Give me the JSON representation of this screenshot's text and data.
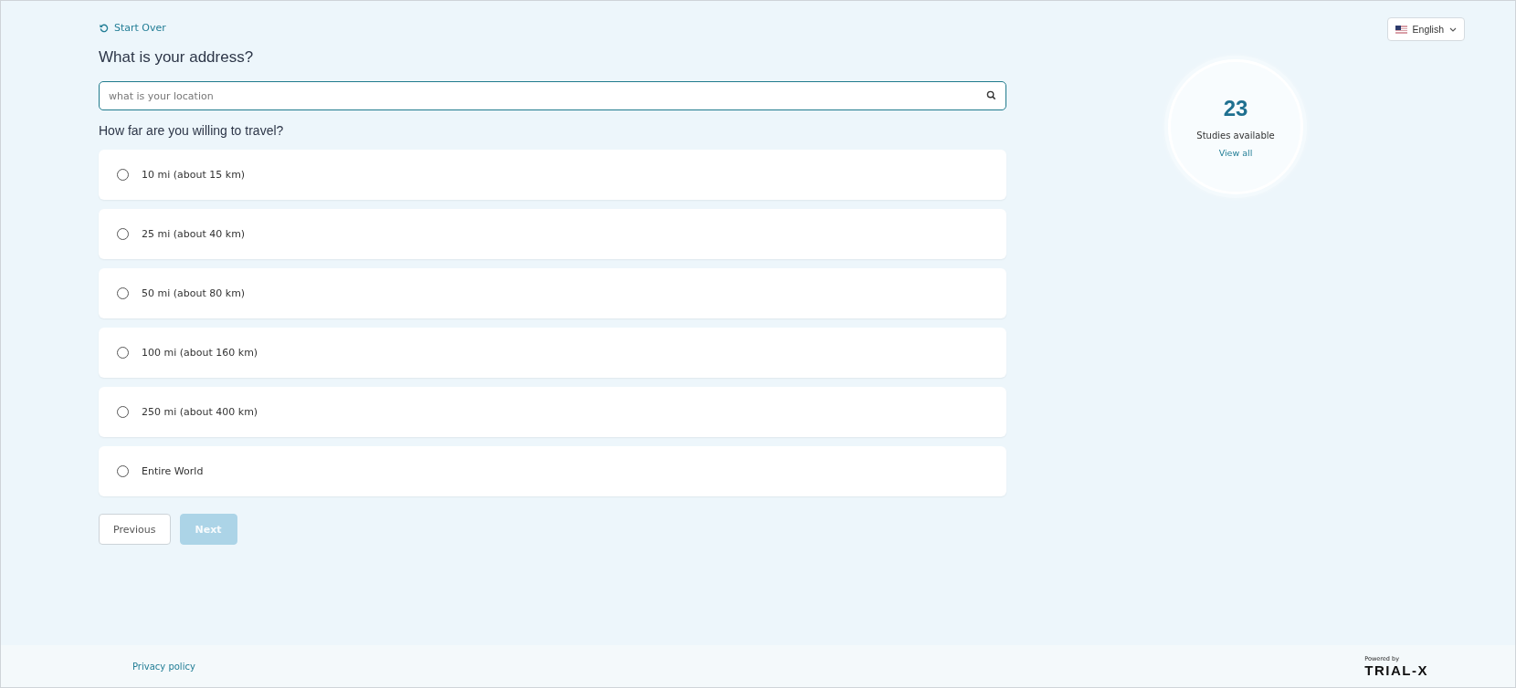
{
  "start_over": {
    "label": "Start Over"
  },
  "language": {
    "label": "English"
  },
  "address": {
    "question": "What is your address?",
    "search": {
      "placeholder": "what is your location"
    }
  },
  "travel": {
    "question": "How far are you willing to travel?",
    "options": [
      {
        "label": "10 mi (about 15 km)",
        "selected": false
      },
      {
        "label": "25 mi (about 40 km)",
        "selected": false
      },
      {
        "label": "50 mi (about 80 km)",
        "selected": false
      },
      {
        "label": "100 mi (about 160 km)",
        "selected": false
      },
      {
        "label": "250 mi (about 400 km)",
        "selected": false
      },
      {
        "label": "Entire World",
        "selected": false
      }
    ]
  },
  "buttons": [
    {
      "label": "Previous",
      "kind": "secondary",
      "disabled": false
    },
    {
      "label": "Next",
      "kind": "primary",
      "disabled": true
    }
  ],
  "studies": {
    "count": "23",
    "label": "Studies available",
    "link": "View all"
  },
  "footer": {
    "privacy": "Privacy policy",
    "powered_by": "Powered by",
    "logo": "TRIAL-X"
  }
}
